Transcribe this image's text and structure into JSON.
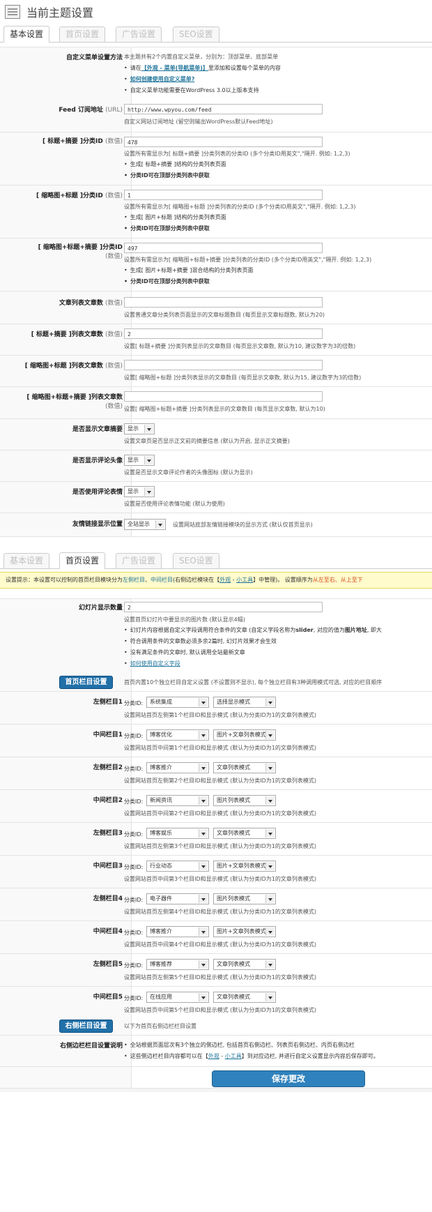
{
  "page_title": "当前主题设置",
  "tabs_top": [
    "基本设置",
    "首页设置",
    "广告设置",
    "SEO设置"
  ],
  "basic": {
    "menu": {
      "label": "自定义菜单设置方法",
      "line1": "本主题共有2个内置自定义菜单，分别为：顶部菜单、底部菜单",
      "line2_pre": "请在",
      "line2_link": "【外观 - 菜单(导航菜单)】",
      "line2_post": "里添加和设置每个菜单的内容",
      "line3_link": "如何创建使用自定义菜单?",
      "line4": "自定义菜单功能需要在WordPress 3.0以上版本支持"
    },
    "feed": {
      "label": "Feed 订阅地址",
      "sub": "(URL)",
      "value": "http://www.wpyou.com/feed",
      "desc": "自定义网站订阅地址 (留空则输出WordPress默认Feed地址)"
    },
    "cat1": {
      "label": "[ 标题+摘要 ]分类ID",
      "sub": "(数值)",
      "value": "478",
      "desc": "设置所有需显示为[ 标题+摘要 ]分类列表的分类ID (多个分类ID用英文\",\"隔开. 例如: 1,2,3)",
      "b1": "生成[ 标题+摘要 ]结构的分类列表页面",
      "b2": "分类ID可在顶部分类列表中获取"
    },
    "cat2": {
      "label": "[ 缩略图+标题 ]分类ID",
      "sub": "(数值)",
      "value": "1",
      "desc": "设置所有需显示为[ 缩略图+标题 ]分类列表的分类ID (多个分类ID用英文\",\"隔开. 例如: 1,2,3)",
      "b1": "生成[ 图片+标题 ]结构的分类列表页面",
      "b2": "分类ID可在顶部分类列表中获取"
    },
    "cat3": {
      "label": "[ 缩略图+标题+摘要 ]分类ID",
      "sub": "(数值)",
      "value": "497",
      "desc": "设置所有需显示为[ 缩略图+标题+摘要 ]分类列表的分类ID (多个分类ID用英文\",\"隔开. 例如: 1,2,3)",
      "b1": "生成[ 图片+标题+摘要 ]混合结构的分类列表页面",
      "b2": "分类ID可在顶部分类列表中获取"
    },
    "count1": {
      "label": "文章列表文章数",
      "sub": "(数值)",
      "value": "",
      "desc": "设置普通文章分类列表页面显示的文章标题数目 (每页显示文章标题数, 默认为20)"
    },
    "count2": {
      "label": "[ 标题+摘要 ]列表文章数",
      "sub": "(数值)",
      "value": "2",
      "desc": "设置[ 标题+摘要 ]分类列表显示的文章数目 (每页显示文章数, 默认为10, 建议数字为3的倍数)"
    },
    "count3": {
      "label": "[ 缩略图+标题 ]列表文章数",
      "sub": "(数值)",
      "value": "",
      "desc": "设置[ 缩略图+标题 ]分类列表显示的文章数目 (每页显示文章数, 默认为15, 建议数字为3的倍数)"
    },
    "count4": {
      "label": "[ 缩略图+标题+摘要 ]列表文章数",
      "sub": "(数值)",
      "value": "",
      "desc": "设置[ 缩略图+标题+摘要 ]分类列表显示的文章数目 (每页显示文章数, 默认为10)"
    },
    "excerpt": {
      "label": "是否显示文章摘要",
      "value": "显示",
      "desc": "设置文章页是否显示正文前的摘要信息 (默认为开启, 显示正文摘要)"
    },
    "avatar": {
      "label": "是否显示评论头像",
      "value": "显示",
      "desc": "设置是否显示文章评论作者的头像图标 (默认为显示)"
    },
    "smiley": {
      "label": "是否使用评论表情",
      "value": "显示",
      "desc": "设置是否使用评论表情功能 (默认为使用)"
    },
    "links": {
      "label": "友情链接显示位置",
      "value": "全站显示",
      "desc": "设置网站底部友情链接模块的显示方式 (默认仅首页显示)"
    }
  },
  "tabs_home": [
    "基本设置",
    "首页设置",
    "广告设置",
    "SEO设置"
  ],
  "hint": {
    "p1": "设置提示：本设置可以控制的首页栏目模块分为",
    "left": "左侧栏目",
    "sep": "、",
    "mid": "中间栏目",
    "p2": "(右侧边栏模块在【",
    "l1": "外观",
    "dash": " - ",
    "l2": "小工具",
    "p3": "】中管理)。 设置顺序为",
    "order": "从左至右、从上至下"
  },
  "home": {
    "slider": {
      "label": "幻灯片显示数量",
      "value": "2",
      "desc": "设置首页幻灯片中要显示的图片数 (默认显示4幅)",
      "b1_pre": "幻灯片内容根据自定义字段调用符合条件的文章 (自定义字段名称为",
      "b1_key": "slider",
      "b1_mid": ", 对应的值为",
      "b1_val": "图片地址",
      "b1_post": ", 即大",
      "b2": "符合调用条件的文章数必须多余2篇时, 幻灯片效果才会生效",
      "b3": "没有满足条件的文章时, 默认调用全站最新文章",
      "link": "如何使用自定义字段"
    },
    "columns_btn": "首页栏目设置",
    "columns_desc": "首页内置10个独立栏目自定义设置 (不设置则不显示), 每个独立栏目有3种调用模式可选, 对应的栏目顺序",
    "cat_prefix": "分类ID:",
    "columns": [
      {
        "label": "左侧栏目1",
        "cat": "系统集成",
        "mode": "选择显示模式",
        "desc": "设置网站首页左侧第1个栏目ID和显示模式 (默认为分类ID为1的文章列表模式)"
      },
      {
        "label": "中间栏目1",
        "cat": "博客优化",
        "mode": "图片+文章列表模式",
        "desc": "设置网站首页中间第1个栏目ID和显示模式 (默认为分类ID为1的文章列表模式)"
      },
      {
        "label": "左侧栏目2",
        "cat": "博客推介",
        "mode": "文章列表模式",
        "desc": "设置网站首页左侧第2个栏目ID和显示模式 (默认为分类ID为1的文章列表模式)"
      },
      {
        "label": "中间栏目2",
        "cat": "新闻资讯",
        "mode": "图片列表模式",
        "desc": "设置网站首页中间第2个栏目ID和显示模式 (默认为分类ID为1的文章列表模式)"
      },
      {
        "label": "左侧栏目3",
        "cat": "博客娱乐",
        "mode": "文章列表模式",
        "desc": "设置网站首页左侧第3个栏目ID和显示模式 (默认为分类ID为1的文章列表模式)"
      },
      {
        "label": "中间栏目3",
        "cat": "行业动态",
        "mode": "图片+文章列表模式",
        "desc": "设置网站首页中间第3个栏目ID和显示模式 (默认为分类ID为1的文章列表模式)"
      },
      {
        "label": "左侧栏目4",
        "cat": "电子器件",
        "mode": "图片列表模式",
        "desc": "设置网站首页左侧第4个栏目ID和显示模式 (默认为分类ID为1的文章列表模式)"
      },
      {
        "label": "中间栏目4",
        "cat": "博客推介",
        "mode": "图片+文章列表模式",
        "desc": "设置网站首页中间第4个栏目ID和显示模式 (默认为分类ID为1的文章列表模式)"
      },
      {
        "label": "左侧栏目5",
        "cat": "博客推荐",
        "mode": "文章列表模式",
        "desc": "设置网站首页左侧第5个栏目ID和显示模式 (默认为分类ID为1的文章列表模式)"
      },
      {
        "label": "中间栏目5",
        "cat": "在线应用",
        "mode": "文章列表模式",
        "desc": "设置网站首页中间第5个栏目ID和显示模式 (默认为分类ID为1的文章列表模式)"
      }
    ],
    "sidebar_btn": "右侧栏目设置",
    "sidebar_desc": "以下为首页右侧边栏栏目设置",
    "sidebar_info": {
      "label": "右侧边栏栏目设置说明",
      "b1": "全站根据页面层次有3个独立的侧边栏, 包括首页右侧边栏、列表页右侧边栏、内页右侧边栏",
      "b2_pre": "这些侧边栏栏目内容都可以在【",
      "l1": "外观",
      "dash": " - ",
      "l2": "小工具",
      "b2_post": "】到对应边栏, 并进行自定义设置显示内容后保存即可。"
    },
    "save": "保存更改"
  }
}
